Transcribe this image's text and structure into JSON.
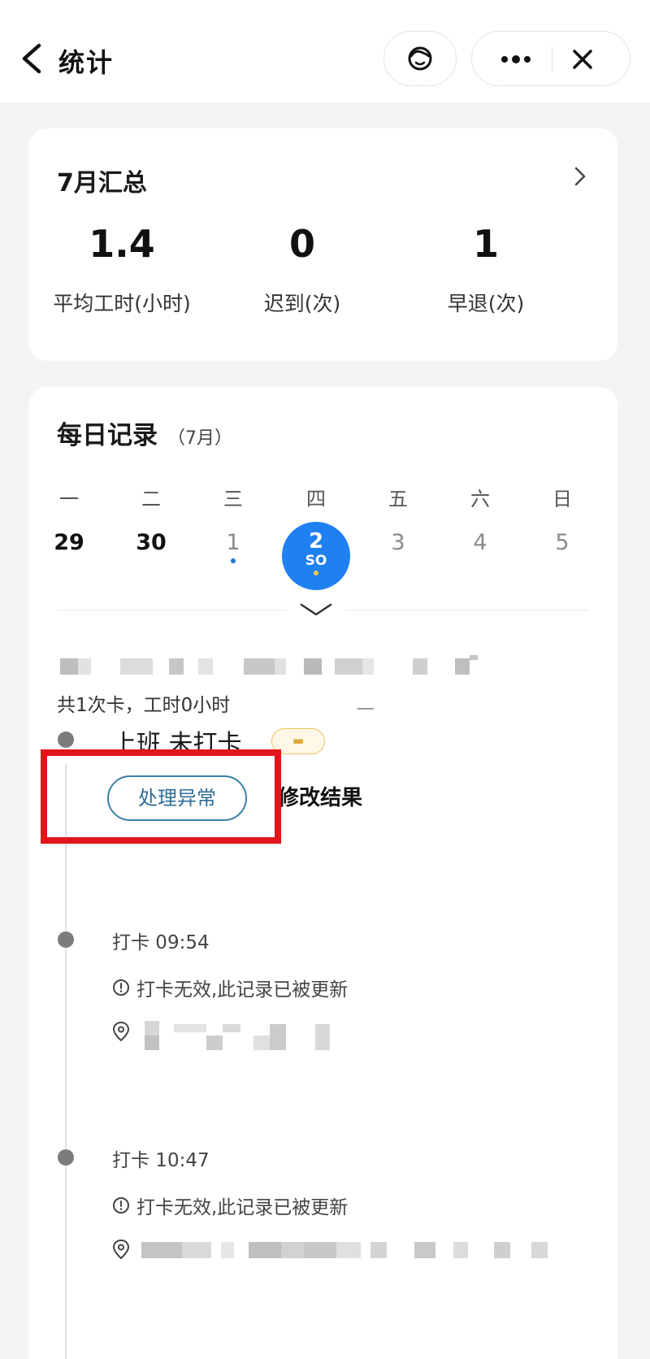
{
  "header": {
    "title": "统计"
  },
  "summary": {
    "title": "7月汇总",
    "stats": [
      {
        "value": "1.4",
        "label": "平均工时(小时)"
      },
      {
        "value": "0",
        "label": "迟到(次)"
      },
      {
        "value": "1",
        "label": "早退(次)"
      }
    ]
  },
  "daily": {
    "title": "每日记录",
    "month": "（7月）",
    "weekdays": [
      "一",
      "二",
      "三",
      "四",
      "五",
      "六",
      "日"
    ],
    "days": [
      "29",
      "30",
      "1",
      "2",
      "3",
      "4",
      "5"
    ],
    "today_sub": "SO",
    "summary_line": "共1次卡，工时0小时",
    "event": {
      "title": "上班 未打卡",
      "handle_button": "处理异常",
      "modify_button": "修改结果"
    },
    "punches": [
      {
        "time": "打卡 09:54",
        "note": "打卡无效,此记录已被更新"
      },
      {
        "time": "打卡 10:47",
        "note": "打卡无效,此记录已被更新"
      }
    ]
  }
}
